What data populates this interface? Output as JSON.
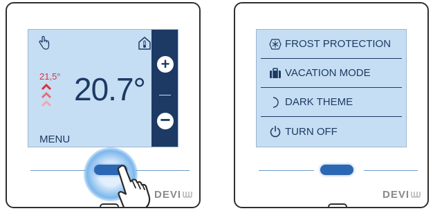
{
  "left_device": {
    "setpoint": "21,5°",
    "temperature": "20.7°",
    "menu_label": "MENU",
    "plus_label": "+",
    "minus_label": "−",
    "brand": "DEVI"
  },
  "right_device": {
    "menu_items": [
      {
        "label": "FROST PROTECTION",
        "icon": "snowflake-icon"
      },
      {
        "label": "VACATION MODE",
        "icon": "suitcase-icon"
      },
      {
        "label": "DARK THEME",
        "icon": "moon-icon"
      },
      {
        "label": "TURN OFF",
        "icon": "power-icon"
      }
    ],
    "brand": "DEVI"
  },
  "colors": {
    "screen_bg": "#c6def3",
    "navy": "#1c3a64",
    "setpoint_red": "#d93340",
    "button_blue": "#2c67b4"
  }
}
